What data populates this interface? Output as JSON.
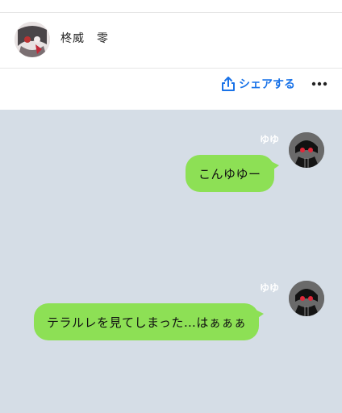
{
  "header": {
    "name": "柊威　零"
  },
  "toolbar": {
    "share_label": "シェアする",
    "share_icon": "share-icon",
    "more_icon": "more-icon"
  },
  "messages": [
    {
      "sender": "ゆゆ",
      "text": "こんゆゆー"
    },
    {
      "sender": "ゆゆ",
      "text": "テラルレを見てしまった…はぁぁぁ"
    }
  ],
  "colors": {
    "chat_bg": "#d5dde6",
    "bubble": "#8de055",
    "accent": "#1a73e8"
  }
}
